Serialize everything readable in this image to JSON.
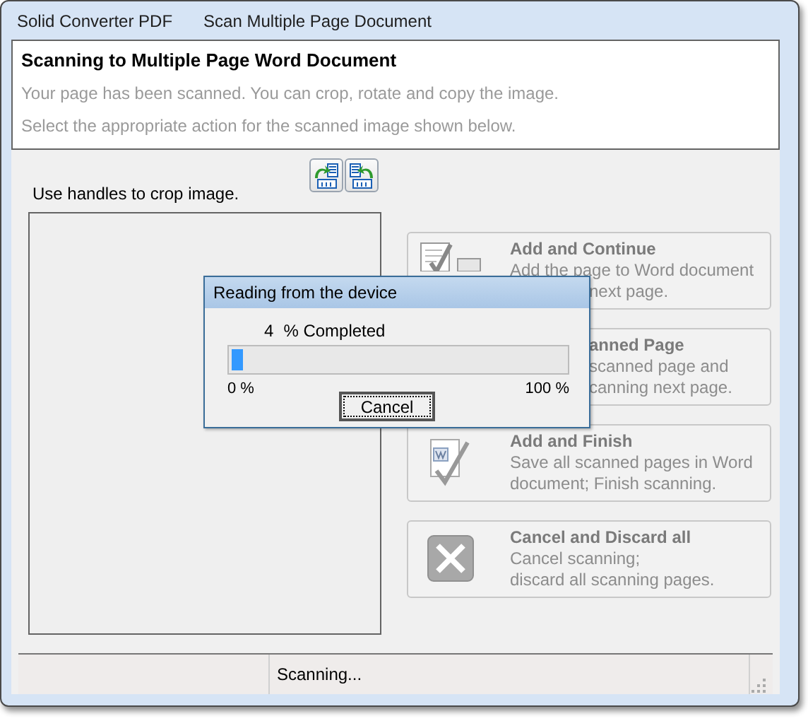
{
  "window": {
    "app_name": "Solid Converter PDF",
    "title": "Scan Multiple Page Document"
  },
  "header": {
    "heading": "Scanning to Multiple Page Word Document",
    "lines": [
      "Your page has been scanned. You can crop, rotate and copy the image.",
      "Select the appropriate action for the scanned image shown below."
    ]
  },
  "crop": {
    "hint": "Use handles to crop image.",
    "tools": [
      {
        "kind": "rotate-left"
      },
      {
        "kind": "rotate-right"
      }
    ]
  },
  "actions": [
    {
      "kind": "continue",
      "title": {
        "text": "Add and Continue",
        "clipped": false
      },
      "lines": [
        {
          "text": "Add the page to Word document",
          "clipped": false
        },
        {
          "text": "next page.",
          "clipped": true
        }
      ]
    },
    {
      "kind": "next",
      "title": {
        "text": "anned Page",
        "clipped": true
      },
      "lines": [
        {
          "text": "scanned page and",
          "clipped": true
        },
        {
          "text": "canning next page.",
          "clipped": true
        }
      ]
    },
    {
      "kind": "finish",
      "title": {
        "text": "Add and Finish",
        "clipped": false
      },
      "lines": [
        {
          "text": "Save all scanned pages in Word",
          "clipped": false
        },
        {
          "text": "document; Finish scanning.",
          "clipped": false
        }
      ]
    },
    {
      "kind": "cancel",
      "title": {
        "text": "Cancel and Discard all",
        "clipped": false
      },
      "lines": [
        {
          "text": "Cancel scanning;",
          "clipped": false
        },
        {
          "text": "discard all scanning pages.",
          "clipped": false
        }
      ]
    }
  ],
  "progress_dialog": {
    "title": "Reading from the device",
    "percent": "4",
    "suffix": "% Completed",
    "level": 0.04,
    "min_label": "0 %",
    "max_label": "100 %",
    "button": "Cancel"
  },
  "status_bar": {
    "text": "Scanning..."
  }
}
